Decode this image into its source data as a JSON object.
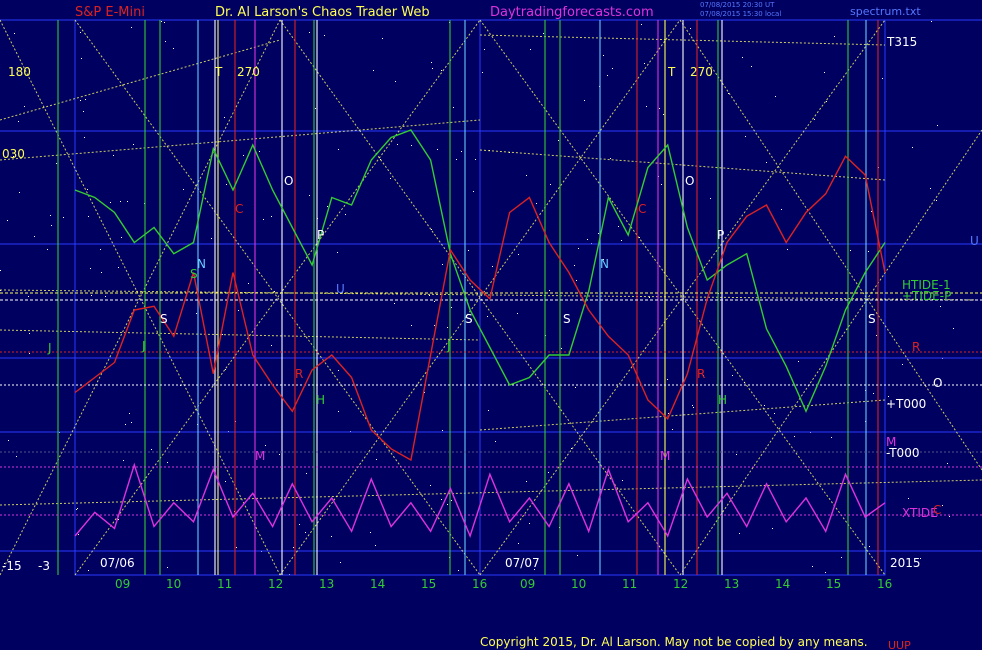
{
  "header": {
    "symbol": "S&P E-Mini",
    "title": "Dr. Al Larson's Chaos Trader Web",
    "site": "Daytradingforecasts.com",
    "stamp_line1": "07/08/2015 20:30 UT",
    "stamp_line2": "07/08/2015 15:30 local",
    "file": "spectrum.txt"
  },
  "footer": {
    "copyright": "Copyright 2015, Dr. Al Larson. May not be copied by any means.",
    "corner": "UUP"
  },
  "chart_data": {
    "type": "line",
    "title": "S&P E-Mini",
    "days": [
      {
        "date": "07/06",
        "hours": [
          "09",
          "10",
          "11",
          "12",
          "13",
          "14",
          "15",
          "16"
        ]
      },
      {
        "date": "07/07",
        "hours": [
          "09",
          "10",
          "11",
          "12",
          "13",
          "14",
          "15",
          "16"
        ]
      }
    ],
    "year": "2015",
    "left_scale": [
      "180",
      "030",
      "-15",
      "-3"
    ],
    "right_labels": [
      "T315",
      "HTIDE-1",
      "+TIDE-P",
      "R",
      "O",
      "+T000",
      "M",
      "-T000",
      "XTIDE",
      "C",
      "U"
    ],
    "series": [
      {
        "name": "+TIDE-P",
        "color": "#33cc33",
        "values": [
          0.72,
          0.7,
          0.66,
          0.58,
          0.62,
          0.55,
          0.58,
          0.83,
          0.72,
          0.84,
          0.72,
          0.62,
          0.52,
          0.7,
          0.68,
          0.8,
          0.86,
          0.88,
          0.8,
          0.55,
          0.4,
          0.3,
          0.2,
          0.22,
          0.28,
          0.28,
          0.45,
          0.7,
          0.6,
          0.78,
          0.84,
          0.62,
          0.48,
          0.52,
          0.55,
          0.35,
          0.25,
          0.13,
          0.25,
          0.4,
          0.5,
          0.58
        ]
      },
      {
        "name": "HTIDE-1",
        "color": "#dd2222",
        "values": [
          0.3,
          0.34,
          0.38,
          0.52,
          0.53,
          0.45,
          0.62,
          0.35,
          0.62,
          0.4,
          0.32,
          0.25,
          0.36,
          0.4,
          0.34,
          0.2,
          0.15,
          0.12,
          0.4,
          0.68,
          0.6,
          0.55,
          0.78,
          0.82,
          0.7,
          0.62,
          0.52,
          0.45,
          0.4,
          0.28,
          0.23,
          0.35,
          0.55,
          0.7,
          0.77,
          0.8,
          0.7,
          0.78,
          0.83,
          0.93,
          0.88,
          0.62
        ]
      },
      {
        "name": "XTIDE",
        "color": "#dd33dd",
        "values": [
          0.2,
          0.45,
          0.28,
          0.95,
          0.3,
          0.55,
          0.35,
          0.9,
          0.4,
          0.65,
          0.3,
          0.75,
          0.35,
          0.6,
          0.25,
          0.8,
          0.3,
          0.55,
          0.25,
          0.7,
          0.2,
          0.85,
          0.35,
          0.6,
          0.3,
          0.75,
          0.25,
          0.9,
          0.35,
          0.55,
          0.2,
          0.8,
          0.4,
          0.65,
          0.3,
          0.75,
          0.35,
          0.6,
          0.25,
          0.85,
          0.4,
          0.55
        ]
      }
    ],
    "vertical_markers": [
      "S",
      "S",
      "S",
      "S",
      "S",
      "N",
      "N",
      "C",
      "C",
      "O",
      "O",
      "P",
      "P",
      "R",
      "R",
      "H",
      "H",
      "M",
      "M",
      "J",
      "J",
      "J",
      "U",
      "T",
      "T",
      "270",
      "270"
    ],
    "grid": true
  }
}
